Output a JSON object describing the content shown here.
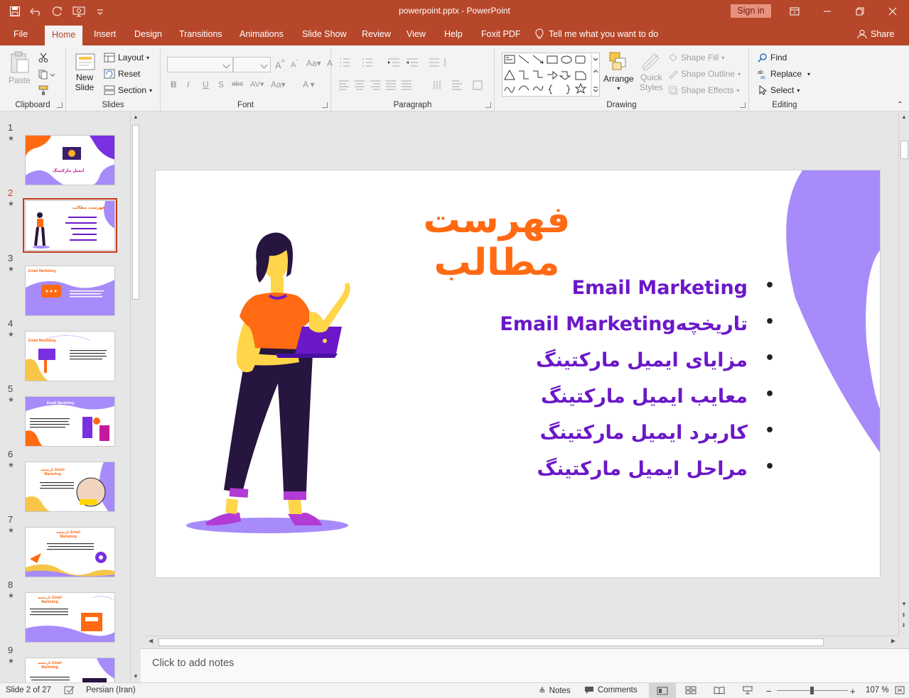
{
  "app": {
    "doc_title": "powerpoint.pptx  -  PowerPoint",
    "signin_label": "Sign in"
  },
  "tabs": [
    "File",
    "Home",
    "Insert",
    "Design",
    "Transitions",
    "Animations",
    "Slide Show",
    "Review",
    "View",
    "Help",
    "Foxit PDF"
  ],
  "active_tab": "Home",
  "tell_me": "Tell me what you want to do",
  "share_label": "Share",
  "ribbon": {
    "clipboard": {
      "label": "Clipboard",
      "paste": "Paste"
    },
    "slides": {
      "label": "Slides",
      "new_slide_1": "New",
      "new_slide_2": "Slide",
      "layout": "Layout",
      "reset": "Reset",
      "section": "Section"
    },
    "font": {
      "label": "Font"
    },
    "paragraph": {
      "label": "Paragraph"
    },
    "drawing": {
      "label": "Drawing",
      "arrange": "Arrange",
      "quick_styles_1": "Quick",
      "quick_styles_2": "Styles",
      "shape_fill": "Shape Fill",
      "shape_outline": "Shape Outline",
      "shape_effects": "Shape Effects"
    },
    "editing": {
      "label": "Editing",
      "find": "Find",
      "replace": "Replace",
      "select": "Select"
    }
  },
  "thumbnails": [
    {
      "num": "1",
      "title": "ایمیل مارکتینگ"
    },
    {
      "num": "2",
      "title": "فهرست مطالب"
    },
    {
      "num": "3",
      "title": "Email Marketing"
    },
    {
      "num": "4",
      "title": "Email Marketing"
    },
    {
      "num": "5",
      "title": "Email Marketing"
    },
    {
      "num": "6",
      "title": "تاریخچه Email Marketing"
    },
    {
      "num": "7",
      "title": "تاریخچه Email Marketing"
    },
    {
      "num": "8",
      "title": "تاریخچه Email Marketing"
    },
    {
      "num": "9",
      "title": "تاریخچه Email Marketing"
    }
  ],
  "active_slide": "2",
  "slide": {
    "title": "فهرست مطالب",
    "bullets": [
      "Email Marketing",
      "تاریخچهEmail Marketing",
      "مزایای ایمیل مارکتینگ",
      "معایب ایمیل مارکتینگ",
      "کاربرد ایمیل مارکتینگ",
      "مراحل ایمیل مارکتینگ"
    ],
    "colors": {
      "title": "#ff6a13",
      "bullets": "#6b18c8",
      "accent": "#a78bfa"
    }
  },
  "notes_placeholder": "Click to add notes",
  "status": {
    "slide_indicator": "Slide 2 of 27",
    "language": "Persian (Iran)",
    "notes": "Notes",
    "comments": "Comments",
    "zoom": "107 %"
  }
}
